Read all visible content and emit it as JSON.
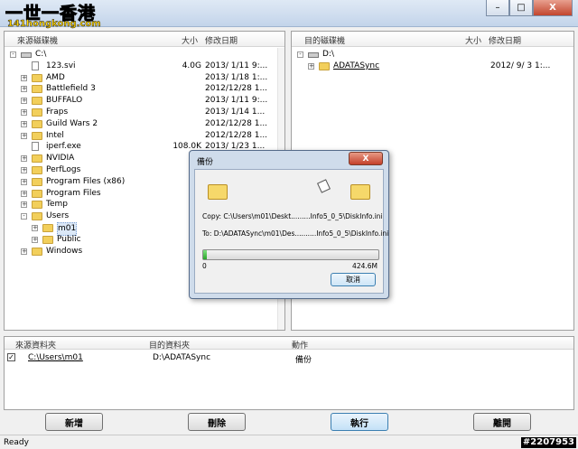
{
  "logo": {
    "line1": "一世一香港",
    "line2": "141hongkong.com"
  },
  "window": {
    "min": "–",
    "max": "□",
    "close": "X"
  },
  "left_pane": {
    "headers": {
      "name": "來源磁碟機",
      "size": "大小",
      "date": "修改日期"
    },
    "rows": [
      {
        "kind": "drive",
        "name": "C:\\",
        "size": "",
        "date": "",
        "level": 0,
        "exp": "-"
      },
      {
        "kind": "file",
        "name": "123.svi",
        "size": "4.0G",
        "date": "2013/ 1/11  9:...",
        "level": 1,
        "exp": ""
      },
      {
        "kind": "folder",
        "name": "AMD",
        "size": "",
        "date": "2013/ 1/18  1:...",
        "level": 1,
        "exp": "+"
      },
      {
        "kind": "folder",
        "name": "Battlefield 3",
        "size": "",
        "date": "2012/12/28  1...",
        "level": 1,
        "exp": "+"
      },
      {
        "kind": "folder",
        "name": "BUFFALO",
        "size": "",
        "date": "2013/ 1/11  9:...",
        "level": 1,
        "exp": "+"
      },
      {
        "kind": "folder",
        "name": "Fraps",
        "size": "",
        "date": "2013/ 1/14  1...",
        "level": 1,
        "exp": "+"
      },
      {
        "kind": "folder",
        "name": "Guild Wars 2",
        "size": "",
        "date": "2012/12/28  1...",
        "level": 1,
        "exp": "+"
      },
      {
        "kind": "folder",
        "name": "Intel",
        "size": "",
        "date": "2012/12/28  1...",
        "level": 1,
        "exp": "+"
      },
      {
        "kind": "file",
        "name": "iperf.exe",
        "size": "108.0K",
        "date": "2013/ 1/23  1...",
        "level": 1,
        "exp": ""
      },
      {
        "kind": "folder",
        "name": "NVIDIA",
        "size": "",
        "date": "",
        "level": 1,
        "exp": "+"
      },
      {
        "kind": "folder",
        "name": "PerfLogs",
        "size": "",
        "date": "",
        "level": 1,
        "exp": "+"
      },
      {
        "kind": "folder",
        "name": "Program Files (x86)",
        "size": "",
        "date": "",
        "level": 1,
        "exp": "+"
      },
      {
        "kind": "folder",
        "name": "Program Files",
        "size": "",
        "date": "",
        "level": 1,
        "exp": "+"
      },
      {
        "kind": "folder",
        "name": "Temp",
        "size": "",
        "date": "",
        "level": 1,
        "exp": "+"
      },
      {
        "kind": "folder",
        "name": "Users",
        "size": "",
        "date": "",
        "level": 1,
        "exp": "-"
      },
      {
        "kind": "folder",
        "name": "m01",
        "size": "",
        "date": "",
        "level": 2,
        "exp": "+",
        "selected": true
      },
      {
        "kind": "folder",
        "name": "Public",
        "size": "",
        "date": "",
        "level": 2,
        "exp": "+"
      },
      {
        "kind": "folder",
        "name": "Windows",
        "size": "",
        "date": "",
        "level": 1,
        "exp": "+"
      }
    ]
  },
  "right_pane": {
    "headers": {
      "name": "目的磁碟機",
      "size": "大小",
      "date": "修改日期"
    },
    "rows": [
      {
        "kind": "drive",
        "name": "D:\\",
        "size": "",
        "date": "",
        "level": 0,
        "exp": "-"
      },
      {
        "kind": "folder",
        "name": "ADATASync",
        "size": "",
        "date": "2012/ 9/ 3  1:...",
        "level": 1,
        "exp": "+",
        "link": true
      }
    ]
  },
  "jobs": {
    "headers": {
      "source": "來源資料夾",
      "dest": "目的資料夾",
      "action": "動作"
    },
    "rows": [
      {
        "checked": "✓",
        "source": "C:\\Users\\m01",
        "dest": "D:\\ADATASync",
        "action": "備份"
      }
    ]
  },
  "buttons": {
    "add": "新增",
    "delete": "刪除",
    "run": "執行",
    "exit": "離開"
  },
  "status": {
    "text": "Ready",
    "stamp": "#2207953"
  },
  "dialog": {
    "title": "備份",
    "close": "X",
    "copy_line": "Copy: C:\\Users\\m01\\Deskt.........Info5_0_5\\DiskInfo.ini",
    "to_line": "To: D:\\ADATASync\\m01\\Des..........Info5_0_5\\DiskInfo.ini",
    "progress_min": "0",
    "progress_max": "424.6M",
    "progress_fraction": 0.02,
    "cancel": "取消"
  }
}
